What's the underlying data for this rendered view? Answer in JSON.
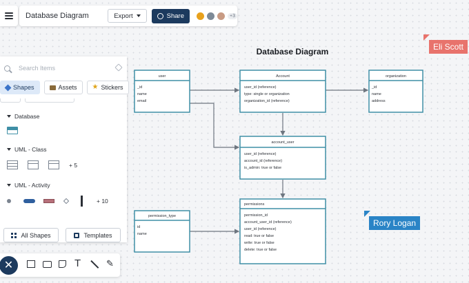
{
  "header": {
    "title": "Database Diagram",
    "export_label": "Export",
    "share_label": "Share",
    "collaborator_count": "+3"
  },
  "search": {
    "placeholder": "Search Items"
  },
  "tabs": [
    {
      "label": "Shapes",
      "active": true
    },
    {
      "label": "Assets",
      "active": false
    },
    {
      "label": "Stickers",
      "active": false
    }
  ],
  "library": {
    "sections": [
      {
        "label": "Database"
      },
      {
        "label": "UML - Class",
        "more": "+ 5"
      },
      {
        "label": "UML - Activity",
        "more": "+ 10"
      }
    ],
    "all_shapes_label": "All Shapes",
    "templates_label": "Templates"
  },
  "diagram": {
    "title": "Database Diagram",
    "tables": {
      "user": {
        "name": "user",
        "fields": [
          "_id",
          "name",
          "email"
        ]
      },
      "account": {
        "name": "Account",
        "fields": [
          "user_id (reference)",
          "type: single or organization",
          "organization_id (reference)"
        ]
      },
      "organization": {
        "name": "organization",
        "fields": [
          "_id",
          "name",
          "address"
        ]
      },
      "account_user": {
        "name": "account_user",
        "fields": [
          "user_id (reference)",
          "account_id (reference)",
          "is_admin: true or false"
        ]
      },
      "permission_type": {
        "name": "permission_type",
        "fields": [
          "id",
          "name"
        ]
      },
      "permissions": {
        "name": "permissions",
        "fields": [
          "permission_id",
          "account_user_id (reference)",
          "user_id (reference)",
          "read: true or false",
          "write: true or false",
          "delete: true or false"
        ]
      }
    }
  },
  "collaborators": {
    "eli": "Eli Scott",
    "rory": "Rory Logan"
  },
  "colors": {
    "table_border": "#3f8fa6",
    "accent": "#1c3a5e",
    "eli": "#e8736c",
    "rory": "#2a84c6"
  }
}
